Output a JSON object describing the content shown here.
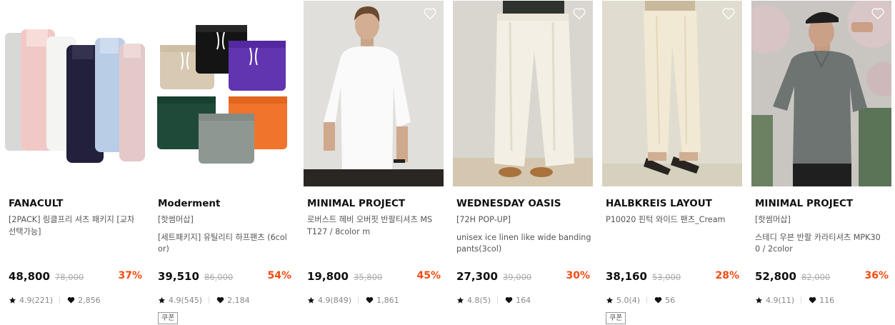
{
  "colors": {
    "accent_discount": "#f44b11",
    "text_primary": "#111111",
    "text_secondary": "#555555",
    "text_muted": "#888888"
  },
  "products": [
    {
      "brand": "FANACULT",
      "desc": [
        "[2PACK] 링클프리 셔츠 패키지 [교차",
        "선택가능]"
      ],
      "price": "48,800",
      "original_price": "78,000",
      "discount": "37%",
      "rating": "4.9(221)",
      "likes": "2,856",
      "coupon": "",
      "image": "folded-shirts-pastel",
      "icon": "heart-outline-icon"
    },
    {
      "brand": "Moderment",
      "desc": [
        "[핫썸머삽]",
        "",
        "[세트패키지] 유틸리티 하프팬츠 (6col",
        "or)"
      ],
      "price": "39,510",
      "original_price": "86,000",
      "discount": "54%",
      "rating": "4.9(545)",
      "likes": "2,184",
      "coupon": "쿠폰",
      "image": "six-half-pants-grid",
      "icon": "heart-outline-icon"
    },
    {
      "brand": "MINIMAL PROJECT",
      "desc": [
        "로버스트 헤비 오버핏 반팔티셔츠 MS",
        "T127 / 8color m"
      ],
      "price": "19,800",
      "original_price": "35,800",
      "discount": "45%",
      "rating": "4.9(849)",
      "likes": "1,861",
      "coupon": "",
      "image": "model-white-tshirt",
      "icon": "heart-outline-icon"
    },
    {
      "brand": "WEDNESDAY OASIS",
      "desc": [
        "[72H POP-UP]",
        "",
        "unisex ice linen like wide banding",
        "pants(3col)"
      ],
      "price": "27,300",
      "original_price": "39,000",
      "discount": "30%",
      "rating": "4.8(5)",
      "likes": "164",
      "coupon": "",
      "image": "cream-wide-pants",
      "icon": "heart-outline-icon"
    },
    {
      "brand": "HALBKREIS LAYOUT",
      "desc": [
        "P10020 핀턱 와이드 팬츠_Cream"
      ],
      "price": "38,160",
      "original_price": "53,000",
      "discount": "28%",
      "rating": "5.0(4)",
      "likes": "56",
      "coupon": "쿠폰",
      "image": "cream-pintuck-pants-sandals",
      "icon": "heart-outline-icon"
    },
    {
      "brand": "MINIMAL PROJECT",
      "desc": [
        "[핫썸머삽]",
        "",
        "스테디 우븐 반팔 카라티셔츠 MPK30",
        "0 / 2color"
      ],
      "price": "52,800",
      "original_price": "82,000",
      "discount": "36%",
      "rating": "4.9(11)",
      "likes": "116",
      "coupon": "",
      "image": "model-grey-collar-shirt",
      "icon": "heart-outline-icon"
    }
  ]
}
